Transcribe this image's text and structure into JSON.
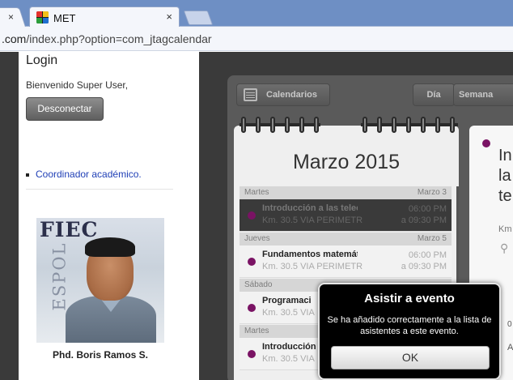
{
  "browser": {
    "prev_tab_close": "×",
    "tab_title": "MET",
    "tab_close": "×",
    "url_host": ".com",
    "url_path": "/index.php?option=com_jtagcalendar"
  },
  "sidebar": {
    "login_title": "Login",
    "welcome": "Bienvenido Super User,",
    "logout_label": "Desconectar",
    "links": [
      "Coordinador académico."
    ],
    "photo_text_1": "FIEC",
    "photo_text_2": "ESPOL",
    "caption": "Phd. Boris Ramos S."
  },
  "calendar": {
    "toolbar": {
      "calendars_label": "Calendarios",
      "day_label": "Día",
      "week_label": "Semana"
    },
    "month_title": "Marzo 2015",
    "groups": [
      {
        "day": "Martes",
        "date": "Marzo 3",
        "event": {
          "title": "Introducción a las telecc",
          "place": "Km. 30.5 VIA PERIMETR",
          "start": "06:00 PM",
          "end": "a 09:30 PM"
        }
      },
      {
        "day": "Jueves",
        "date": "Marzo 5",
        "event": {
          "title": "Fundamentos matemáti",
          "place": "Km. 30.5 VIA PERIMETR",
          "start": "06:00 PM",
          "end": "a 09:30 PM"
        }
      },
      {
        "day": "Sábado",
        "date": "",
        "event": {
          "title": "Programaci",
          "place": "Km. 30.5 VIA",
          "start": "",
          "end": ""
        }
      },
      {
        "day": "Martes",
        "date": "",
        "event": {
          "title": "Introducción",
          "place": "Km. 30.5 VIA",
          "start": "",
          "end": ""
        }
      }
    ],
    "detail": {
      "title": "In\nla\nte",
      "place": "Km",
      "misc1": "0",
      "misc2": "A"
    }
  },
  "modal": {
    "title": "Asistir a evento",
    "message": "Se ha añadido correctamente a la lista de asistentes a este evento.",
    "ok_label": "OK"
  },
  "colors": {
    "event_dot": "#7a1364",
    "link": "#1f3fb6",
    "modal_bg": "#000000"
  }
}
